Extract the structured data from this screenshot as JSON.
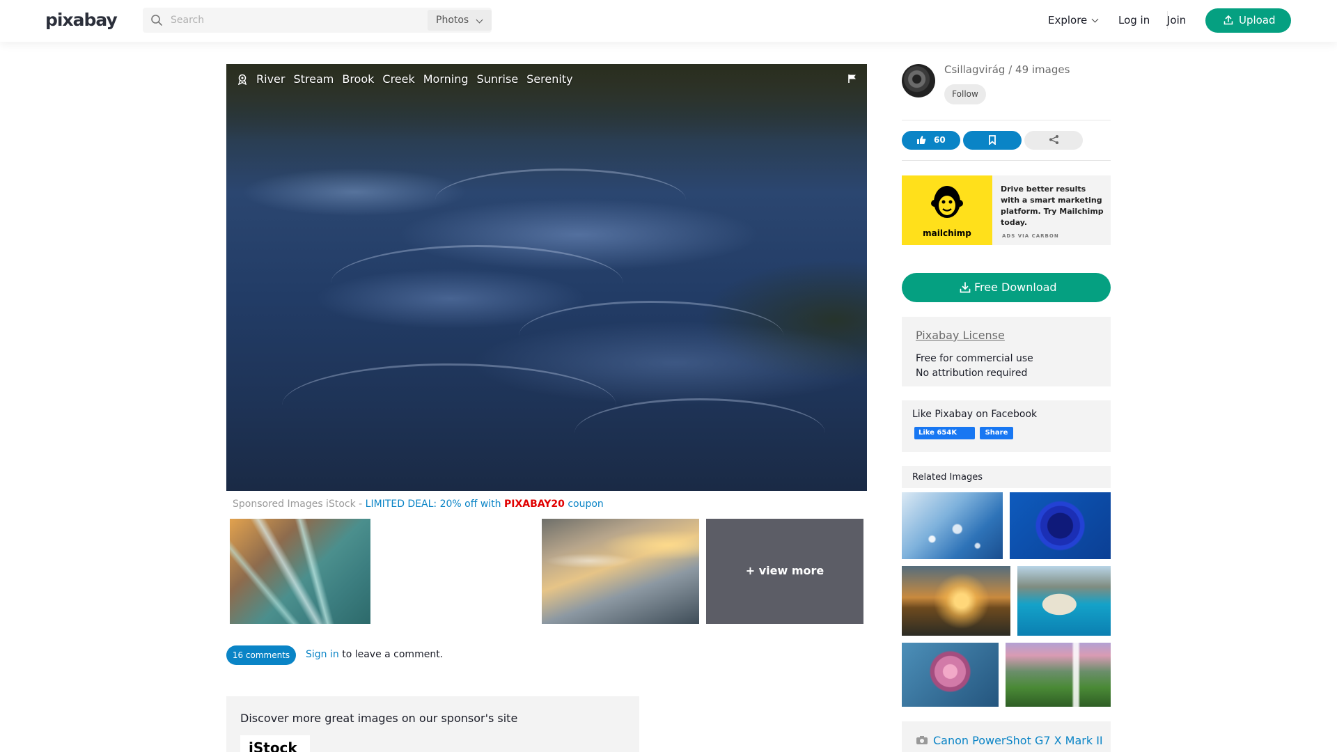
{
  "header": {
    "logo": "pixabay",
    "search_placeholder": "Search",
    "search_type": "Photos",
    "explore": "Explore",
    "login": "Log in",
    "join": "Join",
    "upload": "Upload"
  },
  "image": {
    "tags": [
      "River",
      "Stream",
      "Brook",
      "Creek",
      "Morning",
      "Sunrise",
      "Serenity"
    ]
  },
  "sponsored": {
    "prefix": "Sponsored Images iStock - ",
    "deal": "LIMITED DEAL: 20% off with ",
    "code": "PIXABAY20",
    "suffix": " coupon",
    "view_more": "+ view more"
  },
  "comments": {
    "count_label": "16 comments",
    "signin": "Sign in",
    "signin_suffix": " to leave a comment."
  },
  "sponsor_box": {
    "text": "Discover more great images on our sponsor's site",
    "logo": "iStock"
  },
  "sidebar": {
    "author": "Csillagvirág / 49 images",
    "follow": "Follow",
    "likes": "60",
    "ad": {
      "brand": "mailchimp",
      "text": "Drive better results with a smart marketing platform. Try Mailchimp today.",
      "via": "ADS VIA CARBON"
    },
    "download": "Free Download",
    "license": {
      "title": "Pixabay License",
      "line1": "Free for commercial use",
      "line2": "No attribution required"
    },
    "facebook": {
      "title": "Like Pixabay on Facebook",
      "like": "Like 654K",
      "share": "Share"
    },
    "related_title": "Related Images",
    "camera": "Canon PowerShot G7 X Mark II"
  },
  "colors": {
    "accent_green": "#05a081",
    "accent_blue": "#0a84c6",
    "coupon_red": "#e00000"
  }
}
